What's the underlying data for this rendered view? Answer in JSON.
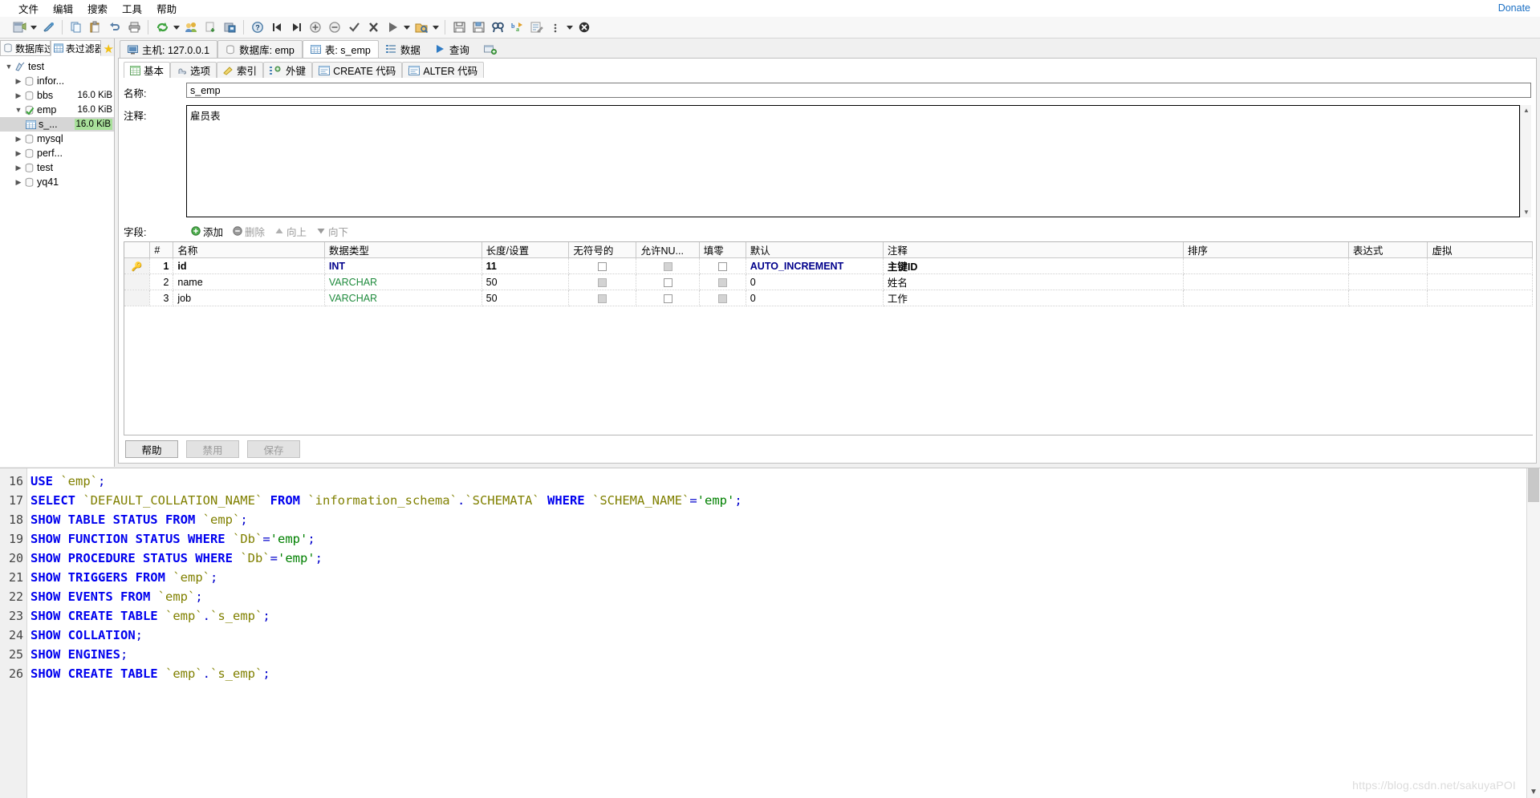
{
  "menu": {
    "items": [
      "文件",
      "编辑",
      "搜索",
      "工具",
      "帮助"
    ],
    "donate": "Donate"
  },
  "toolbar": {
    "items": [
      {
        "name": "connection-icon",
        "label": "连接"
      },
      {
        "name": "connection-dropdown-icon",
        "label": ""
      },
      {
        "name": "new-query-icon",
        "label": "新建查询"
      },
      {
        "name": "copy-icon",
        "label": "复制"
      },
      {
        "name": "paste-icon",
        "label": "粘贴"
      },
      {
        "name": "undo-icon",
        "label": "撤销"
      },
      {
        "name": "print-icon",
        "label": "打印"
      },
      {
        "name": "refresh-icon",
        "label": "刷新"
      },
      {
        "name": "refresh-dropdown-icon",
        "label": ""
      },
      {
        "name": "users-icon",
        "label": "用户管理"
      },
      {
        "name": "import-icon",
        "label": "导入"
      },
      {
        "name": "export-icon",
        "label": "导出"
      },
      {
        "name": "help-icon",
        "label": "帮助"
      },
      {
        "name": "first-record-icon",
        "label": "首条"
      },
      {
        "name": "last-record-icon",
        "label": "末条"
      },
      {
        "name": "insert-row-icon",
        "label": "插入"
      },
      {
        "name": "delete-row-icon",
        "label": "删除"
      },
      {
        "name": "apply-icon",
        "label": "应用"
      },
      {
        "name": "cancel-icon",
        "label": "取消"
      },
      {
        "name": "execute-icon",
        "label": "执行"
      },
      {
        "name": "execute-dropdown-icon",
        "label": ""
      },
      {
        "name": "open-file-icon",
        "label": "打开"
      },
      {
        "name": "open-dropdown-icon",
        "label": ""
      },
      {
        "name": "save-icon",
        "label": "保存"
      },
      {
        "name": "save-as-icon",
        "label": "另存为"
      },
      {
        "name": "find-icon",
        "label": "查找"
      },
      {
        "name": "replace-icon",
        "label": "替换"
      },
      {
        "name": "format-icon",
        "label": "格式化"
      },
      {
        "name": "sql-help-icon",
        "label": "SQL 帮助"
      },
      {
        "name": "more-icon",
        "label": "更多"
      },
      {
        "name": "stop-icon",
        "label": "停止"
      }
    ]
  },
  "sidebar": {
    "filter_tabs": [
      {
        "label": "数据库过",
        "icon": "database-icon",
        "active": false
      },
      {
        "label": "表过滤器",
        "icon": "table-icon",
        "active": true
      }
    ],
    "favorite_icon": "star-icon",
    "tree": [
      {
        "label": "test",
        "size": "",
        "depth": 0,
        "expanded": true,
        "icon": "session-icon",
        "selected": false,
        "highlight": false
      },
      {
        "label": "infor...",
        "size": "",
        "depth": 1,
        "expanded": false,
        "icon": "database-icon",
        "selected": false,
        "highlight": false
      },
      {
        "label": "bbs",
        "size": "16.0 KiB",
        "depth": 1,
        "expanded": false,
        "icon": "database-icon",
        "selected": false,
        "highlight": false
      },
      {
        "label": "emp",
        "size": "16.0 KiB",
        "depth": 1,
        "expanded": true,
        "icon": "database-active-icon",
        "selected": false,
        "highlight": false
      },
      {
        "label": "s_...",
        "size": "16.0 KiB",
        "depth": 2,
        "expanded": null,
        "icon": "table-icon",
        "selected": true,
        "highlight": true
      },
      {
        "label": "mysql",
        "size": "",
        "depth": 1,
        "expanded": false,
        "icon": "database-icon",
        "selected": false,
        "highlight": false
      },
      {
        "label": "perf...",
        "size": "",
        "depth": 1,
        "expanded": false,
        "icon": "database-icon",
        "selected": false,
        "highlight": false
      },
      {
        "label": "test",
        "size": "",
        "depth": 1,
        "expanded": false,
        "icon": "database-icon",
        "selected": false,
        "highlight": false
      },
      {
        "label": "yq41",
        "size": "",
        "depth": 1,
        "expanded": false,
        "icon": "database-icon",
        "selected": false,
        "highlight": false
      }
    ]
  },
  "object_tabs": [
    {
      "label": "主机: 127.0.0.1",
      "icon": "host-icon",
      "active": false
    },
    {
      "label": "数据库: emp",
      "icon": "database-icon",
      "active": false
    },
    {
      "label": "表: s_emp",
      "icon": "table-icon",
      "active": true
    },
    {
      "label": "数据",
      "icon": "data-icon",
      "active": false
    },
    {
      "label": "查询",
      "icon": "query-icon",
      "active": false
    },
    {
      "label": "",
      "icon": "new-tab-icon",
      "active": false
    }
  ],
  "sub_tabs": [
    {
      "label": "基本",
      "icon": "basic-icon",
      "active": true
    },
    {
      "label": "选项",
      "icon": "options-icon",
      "active": false
    },
    {
      "label": "索引",
      "icon": "index-icon",
      "active": false
    },
    {
      "label": "外键",
      "icon": "foreign-key-icon",
      "active": false
    },
    {
      "label": "CREATE 代码",
      "icon": "code-icon",
      "active": false
    },
    {
      "label": "ALTER 代码",
      "icon": "code-icon",
      "active": false
    }
  ],
  "form": {
    "name_label": "名称:",
    "name_value": "s_emp",
    "comment_label": "注释:",
    "comment_value": "雇员表"
  },
  "fields": {
    "label": "字段:",
    "actions": [
      {
        "label": "添加",
        "icon": "add-icon",
        "enabled": true
      },
      {
        "label": "删除",
        "icon": "remove-icon",
        "enabled": false
      },
      {
        "label": "向上",
        "icon": "move-up-icon",
        "enabled": false
      },
      {
        "label": "向下",
        "icon": "move-down-icon",
        "enabled": false
      }
    ],
    "columns": [
      "#",
      "名称",
      "数据类型",
      "长度/设置",
      "无符号的",
      "允许NU...",
      "填零",
      "默认",
      "注释",
      "排序",
      "表达式",
      "虚拟"
    ],
    "rows": [
      {
        "key": true,
        "num": "1",
        "name": "id",
        "datatype": "INT",
        "datatype_kind": "int",
        "length": "11",
        "unsigned": "unchecked",
        "nullable": "disabled",
        "zerofill": "unchecked",
        "default": "AUTO_INCREMENT",
        "comment": "主键ID",
        "collation": "",
        "expression": "",
        "virtual": ""
      },
      {
        "key": false,
        "num": "2",
        "name": "name",
        "datatype": "VARCHAR",
        "datatype_kind": "varchar",
        "length": "50",
        "unsigned": "disabled",
        "nullable": "unchecked",
        "zerofill": "disabled",
        "default": "0",
        "comment": "姓名",
        "collation": "",
        "expression": "",
        "virtual": ""
      },
      {
        "key": false,
        "num": "3",
        "name": "job",
        "datatype": "VARCHAR",
        "datatype_kind": "varchar",
        "length": "50",
        "unsigned": "disabled",
        "nullable": "unchecked",
        "zerofill": "disabled",
        "default": "0",
        "comment": "工作",
        "collation": "",
        "expression": "",
        "virtual": ""
      }
    ]
  },
  "buttons": [
    {
      "label": "帮助",
      "enabled": true
    },
    {
      "label": "禁用",
      "enabled": false
    },
    {
      "label": "保存",
      "enabled": false
    }
  ],
  "log": {
    "lines": [
      {
        "no": "16",
        "tokens": [
          [
            "kw",
            "USE"
          ],
          [
            "sp",
            " "
          ],
          [
            "ident",
            "`emp`"
          ],
          [
            "punc",
            ";"
          ]
        ]
      },
      {
        "no": "17",
        "tokens": [
          [
            "kw",
            "SELECT"
          ],
          [
            "sp",
            " "
          ],
          [
            "ident",
            "`DEFAULT_COLLATION_NAME`"
          ],
          [
            "sp",
            " "
          ],
          [
            "kw",
            "FROM"
          ],
          [
            "sp",
            " "
          ],
          [
            "ident",
            "`information_schema`"
          ],
          [
            "punc",
            "."
          ],
          [
            "ident",
            "`SCHEMATA`"
          ],
          [
            "sp",
            " "
          ],
          [
            "kw",
            "WHERE"
          ],
          [
            "sp",
            " "
          ],
          [
            "ident",
            "`SCHEMA_NAME`"
          ],
          [
            "punc",
            "="
          ],
          [
            "str",
            "'emp'"
          ],
          [
            "punc",
            ";"
          ]
        ]
      },
      {
        "no": "18",
        "tokens": [
          [
            "kw",
            "SHOW TABLE STATUS FROM"
          ],
          [
            "sp",
            " "
          ],
          [
            "ident",
            "`emp`"
          ],
          [
            "punc",
            ";"
          ]
        ]
      },
      {
        "no": "19",
        "tokens": [
          [
            "kw",
            "SHOW FUNCTION STATUS WHERE"
          ],
          [
            "sp",
            " "
          ],
          [
            "ident",
            "`Db`"
          ],
          [
            "punc",
            "="
          ],
          [
            "str",
            "'emp'"
          ],
          [
            "punc",
            ";"
          ]
        ]
      },
      {
        "no": "20",
        "tokens": [
          [
            "kw",
            "SHOW PROCEDURE STATUS WHERE"
          ],
          [
            "sp",
            " "
          ],
          [
            "ident",
            "`Db`"
          ],
          [
            "punc",
            "="
          ],
          [
            "str",
            "'emp'"
          ],
          [
            "punc",
            ";"
          ]
        ]
      },
      {
        "no": "21",
        "tokens": [
          [
            "kw",
            "SHOW TRIGGERS FROM"
          ],
          [
            "sp",
            " "
          ],
          [
            "ident",
            "`emp`"
          ],
          [
            "punc",
            ";"
          ]
        ]
      },
      {
        "no": "22",
        "tokens": [
          [
            "kw",
            "SHOW EVENTS FROM"
          ],
          [
            "sp",
            " "
          ],
          [
            "ident",
            "`emp`"
          ],
          [
            "punc",
            ";"
          ]
        ]
      },
      {
        "no": "23",
        "tokens": [
          [
            "kw",
            "SHOW CREATE TABLE"
          ],
          [
            "sp",
            " "
          ],
          [
            "ident",
            "`emp`"
          ],
          [
            "punc",
            "."
          ],
          [
            "ident",
            "`s_emp`"
          ],
          [
            "punc",
            ";"
          ]
        ]
      },
      {
        "no": "24",
        "tokens": [
          [
            "kw",
            "SHOW COLLATION"
          ],
          [
            "punc",
            ";"
          ]
        ]
      },
      {
        "no": "25",
        "tokens": [
          [
            "kw",
            "SHOW ENGINES"
          ],
          [
            "punc",
            ";"
          ]
        ]
      },
      {
        "no": "26",
        "tokens": [
          [
            "kw",
            "SHOW CREATE TABLE"
          ],
          [
            "sp",
            " "
          ],
          [
            "ident",
            "`emp`"
          ],
          [
            "punc",
            "."
          ],
          [
            "ident",
            "`s_emp`"
          ],
          [
            "punc",
            ";"
          ]
        ]
      }
    ],
    "watermark": "https://blog.csdn.net/sakuyaPOI"
  },
  "colors": {
    "accent": "#1a6fc4",
    "keyword": "#0000ee",
    "identifier": "#808000",
    "string": "#008000",
    "selection": "#d6d6d6",
    "size_highlight": "#a8e09a"
  }
}
